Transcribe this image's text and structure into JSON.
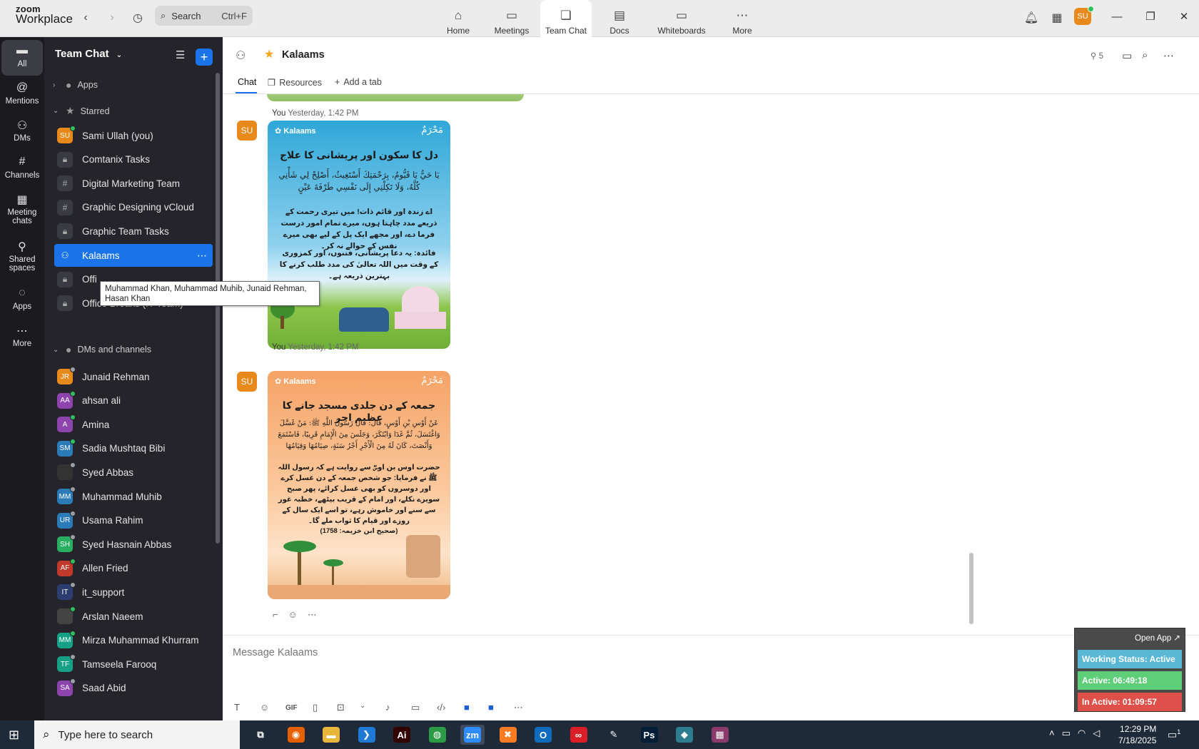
{
  "app": {
    "logo_line1": "zoom",
    "logo_line2": "Workplace"
  },
  "topbar": {
    "search_placeholder": "Search",
    "search_shortcut": "Ctrl+F",
    "nav_tabs": [
      {
        "label": "Home",
        "icon": "home-icon"
      },
      {
        "label": "Meetings",
        "icon": "video-icon"
      },
      {
        "label": "Team Chat",
        "icon": "chat-icon"
      },
      {
        "label": "Docs",
        "icon": "doc-icon"
      },
      {
        "label": "Whiteboards",
        "icon": "whiteboard-icon"
      },
      {
        "label": "More",
        "icon": "more-icon"
      }
    ],
    "user_initials": "SU"
  },
  "rail": {
    "items": [
      {
        "label": "All",
        "icon": "chat-bubble-icon"
      },
      {
        "label": "Mentions",
        "icon": "at-icon"
      },
      {
        "label": "DMs",
        "icon": "people-icon"
      },
      {
        "label": "Channels",
        "icon": "hash-icon"
      },
      {
        "label": "Meeting chats",
        "icon": "calendar-icon"
      },
      {
        "label": "Shared spaces",
        "icon": "shared-icon"
      },
      {
        "label": "Apps",
        "icon": "apps-icon"
      },
      {
        "label": "More",
        "icon": "more-icon"
      }
    ]
  },
  "sidebar": {
    "title": "Team Chat",
    "sections": {
      "apps": "Apps",
      "starred": "Starred",
      "dms": "DMs and channels"
    },
    "starred": [
      {
        "label": "Sami Ullah (you)",
        "type": "avatar",
        "initials": "SU",
        "color": "#e8891c",
        "status": "#2fbf5e"
      },
      {
        "label": "Comtanix Tasks",
        "type": "lock"
      },
      {
        "label": "Digital Marketing Team",
        "type": "hash"
      },
      {
        "label": "Graphic Designing vCloud",
        "type": "hash"
      },
      {
        "label": "Graphic Team Tasks",
        "type": "lock"
      },
      {
        "label": "Kalaams",
        "type": "group",
        "active": true
      },
      {
        "label": "Offi",
        "type": "lock"
      },
      {
        "label": "Office Breaks (IT Team)",
        "type": "lock"
      }
    ],
    "dms": [
      {
        "label": "Junaid Rehman",
        "initials": "JR",
        "color": "#e8891c",
        "status": "#9aa0a6"
      },
      {
        "label": "ahsan ali",
        "initials": "AA",
        "color": "#8e44ad",
        "status": "#2fbf5e"
      },
      {
        "label": "Amina",
        "initials": "A",
        "color": "#8e44ad",
        "status": "#2fbf5e"
      },
      {
        "label": "Sadia Mushtaq Bibi",
        "initials": "SM",
        "color": "#2b7bb9",
        "status": "#2fbf5e"
      },
      {
        "label": "Syed Abbas",
        "initials": "",
        "color": "#333333",
        "status": "#9aa0a6"
      },
      {
        "label": "Muhammad Muhib",
        "initials": "MM",
        "color": "#2b7bb9",
        "status": "#9aa0a6"
      },
      {
        "label": "Usama Rahim",
        "initials": "UR",
        "color": "#2b7bb9",
        "status": "#9aa0a6"
      },
      {
        "label": "Syed Hasnain Abbas",
        "initials": "SH",
        "color": "#27ae60",
        "status": "#9aa0a6"
      },
      {
        "label": "Allen Fried",
        "initials": "AF",
        "color": "#c0392b",
        "status": "#2fbf5e"
      },
      {
        "label": "it_support",
        "initials": "IT",
        "color": "#2c3e70",
        "status": "#9aa0a6"
      },
      {
        "label": "Arslan Naeem",
        "initials": "",
        "color": "#444444",
        "status": "#2fbf5e"
      },
      {
        "label": "Mirza Muhammad Khurram",
        "initials": "MM",
        "color": "#16a085",
        "status": "#2fbf5e"
      },
      {
        "label": "Tamseela Farooq",
        "initials": "TF",
        "color": "#16a085",
        "status": "#9aa0a6"
      },
      {
        "label": "Saad Abid",
        "initials": "SA",
        "color": "#8e44ad",
        "status": "#9aa0a6"
      }
    ]
  },
  "tooltip": "Muhammad Khan, Muhammad Muhib, Junaid Rehman, Hasan Khan",
  "chat": {
    "title": "Kalaams",
    "member_count": "5",
    "tabs": {
      "chat": "Chat",
      "resources": "Resources",
      "add": "Add a tab"
    },
    "messages": [
      {
        "sender": "You",
        "time": "Yesterday, 1:42 PM",
        "initials": "SU",
        "card_brand": "Kalaams",
        "card_script": "مَحْرَمٌ",
        "card_title": "دل کا سکون اور پریشانی کا علاج",
        "card_arabic": "يَا حَيُّ يَا قَيُّومُ، بِرَحْمَتِكَ أَسْتَغِيثُ، أَصْلِحْ لِي شَأْنِي كُلَّهُ، وَلَا تَكِلْنِي إِلَى نَفْسِي طَرْفَةَ عَيْنٍ",
        "card_urdu": "اے زندہ اور قائم ذات! میں تیری رحمت کے ذریعے مدد چاہتا ہوں، میرے تمام امور درست فرما دے، اور مجھے ایک پل کے لیے بھی میرے نفس کے حوالے نہ کر۔",
        "card_note": "فائدہ: یہ دعا پریشانی، فتنوں، اور کمزوری کے وقت میں اللہ تعالیٰ کی مدد طلب کرنے کا بہترین ذریعہ ہے۔"
      },
      {
        "sender": "You",
        "time": "Yesterday, 1:42 PM",
        "initials": "SU",
        "card_brand": "Kalaams",
        "card_script": "مَحْرَمٌ",
        "card_title": "جمعہ کے دن جلدی مسجد جانے کا عظیم اجر",
        "card_arabic": "عَنْ أَوْسِ بْنِ أَوْسٍ، قَالَ: قَالَ رَسُولُ اللَّهِ ﷺ: مَنْ غَسَّلَ وَاغْتَسَلَ، ثُمَّ غَدَا وَابْتَكَرَ، وَجَلَسَ مِنَ الْإِمَامِ قَرِيبًا، فَاسْتَمَعَ وَأَنْصَتَ، كَانَ لَهُ مِنَ الْأَجْرِ أَجْرُ سَنَةٍ، صِيَامُهَا وَقِيَامُهَا",
        "card_urdu": "حضرت اوس بن اوسؓ سے روایت ہے کہ رسول اللہ ﷺ نے فرمایا: جو شخص جمعہ کے دن غسل کرے اور دوسروں کو بھی غسل کرائے، پھر صبح سویرے نکلے، اور امام کے قریب بیٹھے، خطبہ غور سے سنے اور خاموش رہے، تو اسے ایک سال کے روزے اور قیام کا ثواب ملے گا۔",
        "card_note": "(صحیح ابن خزیمہ: 1758)"
      }
    ],
    "composer_placeholder": "Message Kalaams",
    "composer_tools": {
      "gif": "GIF"
    }
  },
  "widget": {
    "open_app": "Open App ↗",
    "working_status": "Working Status: Active",
    "active": "Active: 06:49:18",
    "inactive": "In Active: 01:09:57",
    "colors": {
      "working": "#5bb8d4",
      "active": "#5fce78",
      "inactive": "#e0504a"
    }
  },
  "taskbar": {
    "search_placeholder": "Type here to search",
    "apps": [
      "task-view",
      "firefox",
      "file-explorer",
      "vscode",
      "illustrator",
      "chrome",
      "zoom",
      "xampp",
      "outlook",
      "creative-cloud",
      "pen-tool",
      "photoshop",
      "app",
      "winrar"
    ],
    "time": "12:29 PM",
    "date": "7/18/2025",
    "notif_count": "1"
  }
}
